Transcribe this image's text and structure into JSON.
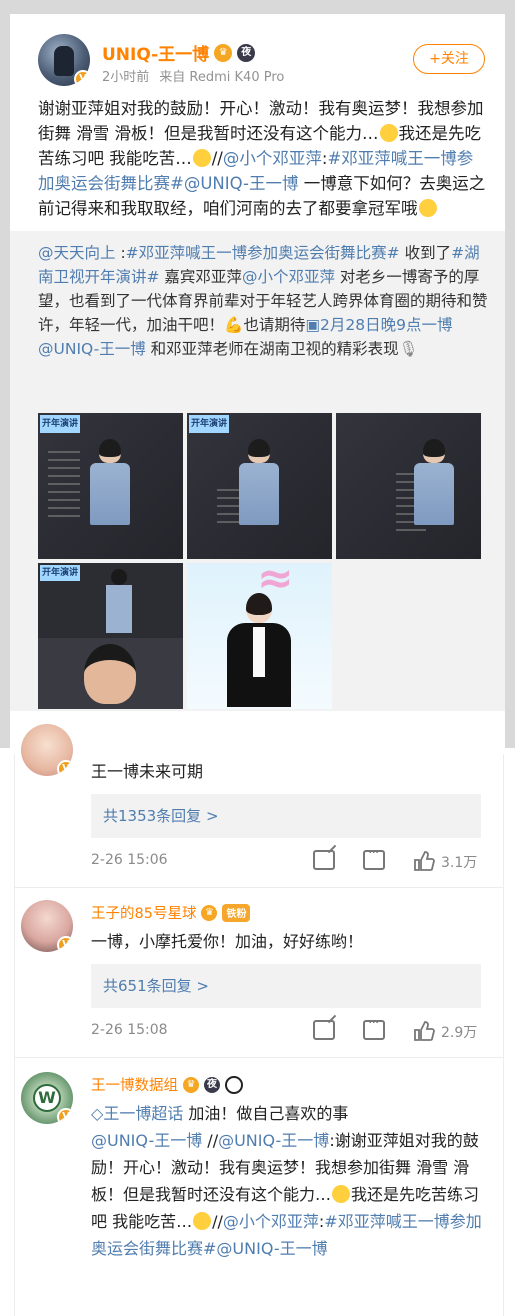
{
  "post": {
    "author": "UNIQ-王一博",
    "time": "2小时前",
    "source": "来自 Redmi K40 Pro",
    "follow_label": "+关注",
    "text_parts": {
      "p1": "谢谢亚萍姐对我的鼓励！开心！激动！我有奥运梦！我想参加街舞 滑雪 滑板！但是我暂时还没有这个能力…",
      "p2": "我还是先吃苦练习吧 我能吃苦…",
      "p3": "//",
      "m1": "@小个邓亚萍",
      "p4": ":",
      "h1": "#邓亚萍喊王一博参加奥运会街舞比赛#",
      "m2": "@UNIQ-王一博",
      "p5": " 一博意下如何？去奥运之前记得来和我取取经，咱们河南的去了都要拿冠军哦"
    }
  },
  "repost": {
    "m1": "@天天向上",
    "p1": " :",
    "h1": "#邓亚萍喊王一博参加奥运会街舞比赛#",
    "p2": " 收到了",
    "h2": "#湖南卫视开年演讲#",
    "p3": " 嘉宾邓亚萍",
    "m2": "@小个邓亚萍",
    "p4": " 对老乡一博寄予的厚望，也看到了一代体育界前辈对于年轻艺人跨界体育圈的期待和赞许，年轻一代，加油干吧！",
    "p5": "也请期待",
    "link": "2月28日晚9点一博",
    "m3": "@UNIQ-王一博",
    "p6": " 和邓亚萍老师在湖南卫视的精彩表现",
    "thumb_tag": "开年演讲"
  },
  "comments": [
    {
      "name": "",
      "text": "王一博未来可期",
      "reply_count": "共1353条回复 >",
      "time": "2-26 15:06",
      "likes": "3.1万"
    },
    {
      "name": "王子的85号星球",
      "badge": "铁粉",
      "text": "一博，小摩托爱你！加油，好好练哟！",
      "reply_count": "共651条回复 >",
      "time": "2-26 15:08",
      "likes": "2.9万"
    },
    {
      "name": "王一博数据组",
      "badge_dark": "夜",
      "super_topic": "王一博超话",
      "t1": " 加油！做自己喜欢的事",
      "m1": "@UNIQ-王一博",
      "t2": " //",
      "m2": "@UNIQ-王一博",
      "t3": ":谢谢亚萍姐对我的鼓励！开心！激动！我有奥运梦！我想参加街舞 滑雪 滑板！但是我暂时还没有这个能力…",
      "t4": "我还是先吃苦练习吧 我能吃苦…",
      "t5": "//",
      "m3": "@小个邓亚萍",
      "t6": ":",
      "h1": "#邓亚萍喊王一博参加奥运会街舞比赛#",
      "m4": "@UNIQ-王一博"
    }
  ],
  "icons": {
    "verified": "V",
    "night": "夜"
  },
  "colors": {
    "orange": "#ff8200",
    "link_blue": "#507daf"
  }
}
